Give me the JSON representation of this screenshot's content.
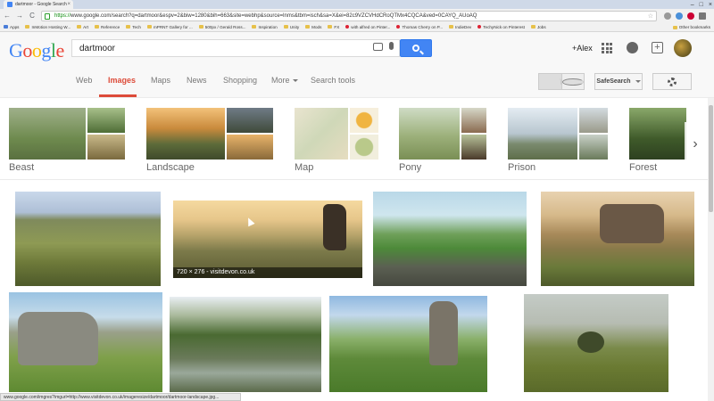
{
  "browser": {
    "tab_title": "dartmoor - Google Search",
    "tab_close": "×",
    "window_controls": [
      "–",
      "□",
      "×"
    ],
    "url_scheme": "https://",
    "url_rest": "www.google.com/search?q=dartmoor&espv=2&biw=1280&bih=663&site=webhp&source=lnms&tbm=isch&sa=X&ei=82c9VZCVHdCRoQTMx4CQCA&ved=0CAYQ_AUoAQ",
    "back": "←",
    "forward": "→",
    "reload": "C",
    "star": "☆",
    "bookmarks": [
      {
        "label": "Apps",
        "icon": "apps-grid"
      },
      {
        "label": "InMotion Hosting W...",
        "icon": "folder"
      },
      {
        "label": "Art",
        "icon": "folder"
      },
      {
        "label": "Reference",
        "icon": "folder"
      },
      {
        "label": "Tech",
        "icon": "folder"
      },
      {
        "label": "mPRNT Gallery for ...",
        "icon": "folder"
      },
      {
        "label": "500px / Gerald Ross...",
        "icon": "folder"
      },
      {
        "label": "Inspiration",
        "icon": "folder"
      },
      {
        "label": "Unity",
        "icon": "folder"
      },
      {
        "label": "Mods",
        "icon": "folder"
      },
      {
        "label": "FX",
        "icon": "folder"
      },
      {
        "label": "with alfred on Pinter...",
        "icon": "pinterest"
      },
      {
        "label": "Thomas Cherry on P...",
        "icon": "pinterest"
      },
      {
        "label": "IndieDev",
        "icon": "folder"
      },
      {
        "label": "TechyNick on Pinterest",
        "icon": "pinterest"
      },
      {
        "label": "Jobs",
        "icon": "folder"
      }
    ],
    "other_bookmarks": "Other bookmarks",
    "status_url": "www.google.com/imgres?imgurl=http://www.visitdevon.co.uk/imageresize/dartmoor/dartmoor-landscape.jpg..."
  },
  "google": {
    "logo": [
      "G",
      "o",
      "o",
      "g",
      "l",
      "e"
    ],
    "query": "dartmoor",
    "user": "+Alex",
    "share_glyph": "+",
    "tabs": [
      "Web",
      "Images",
      "Maps",
      "News",
      "Shopping",
      "More",
      "Search tools"
    ],
    "active_tab": "Images",
    "safesearch": "SafeSearch",
    "related": [
      "Beast",
      "Landscape",
      "Map",
      "Pony",
      "Prison",
      "Forest"
    ],
    "related_next": "›",
    "hover_caption": "720 × 276 - visitdevon.co.uk"
  },
  "colors": {
    "google_blue": "#4285f4",
    "active_tab": "#dd4b39"
  }
}
